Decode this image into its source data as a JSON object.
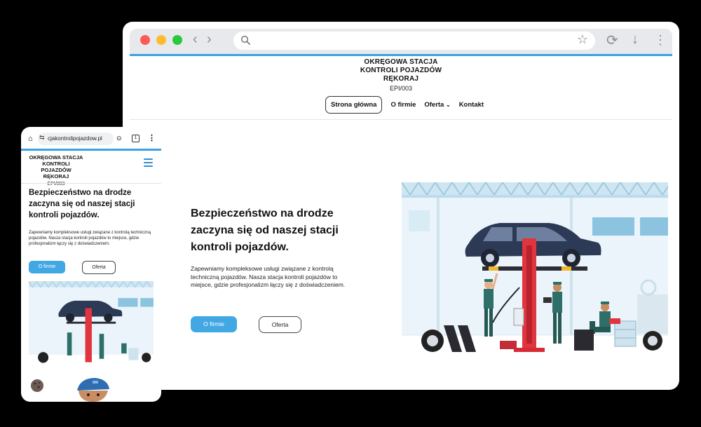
{
  "desktop": {
    "site": {
      "brand_title": "OKRĘGOWA STACJA KONTROLI POJAZDÓW RĘKORAJ",
      "brand_code": "EPI/003"
    },
    "nav": {
      "home": "Strona główna",
      "about": "O firmie",
      "offer": "Oferta",
      "contact": "Kontakt"
    },
    "hero": {
      "headline": "Bezpieczeństwo na drodze zaczyna się od naszej stacji kontroli pojazdów.",
      "paragraph": "Zapewniamy kompleksowe usługi związane z kontrolą techniczną pojazdów. Nasza stacja kontroli pojazdów to miejsce, gdzie profesjonalizm łączy się z doświadczeniem.",
      "btn_primary": "O firmie",
      "btn_secondary": "Oferta"
    }
  },
  "mobile": {
    "url": "cjakontrolipojazdow.pl",
    "brand_title": "OKRĘGOWA STACJA KONTROLI POJAZDÓW RĘKORAJ",
    "brand_code": "EPI/003",
    "headline": "Bezpieczeństwo na drodze zaczyna się od naszej stacji kontroli pojazdów.",
    "paragraph": "Zapewniamy kompleksowe usługi związane z kontrolą techniczną pojazdów. Nasza stacja kontroli pojazdów to miejsce, gdzie profesjonalizm łączy się z doświadczeniem.",
    "btn_primary": "O firmie",
    "btn_secondary": "Oferta",
    "tab_count": "1"
  },
  "colors": {
    "accent_blue": "#42a8e4",
    "lift_red": "#e0343f",
    "car_navy": "#2d3a55",
    "mechanic_teal": "#2f6f6a"
  },
  "icons": [
    "search-icon",
    "star-icon",
    "reload-icon",
    "download-icon",
    "kebab-menu-icon",
    "home-icon",
    "tune-icon",
    "play-icon",
    "hamburger-icon",
    "cookie-icon"
  ]
}
